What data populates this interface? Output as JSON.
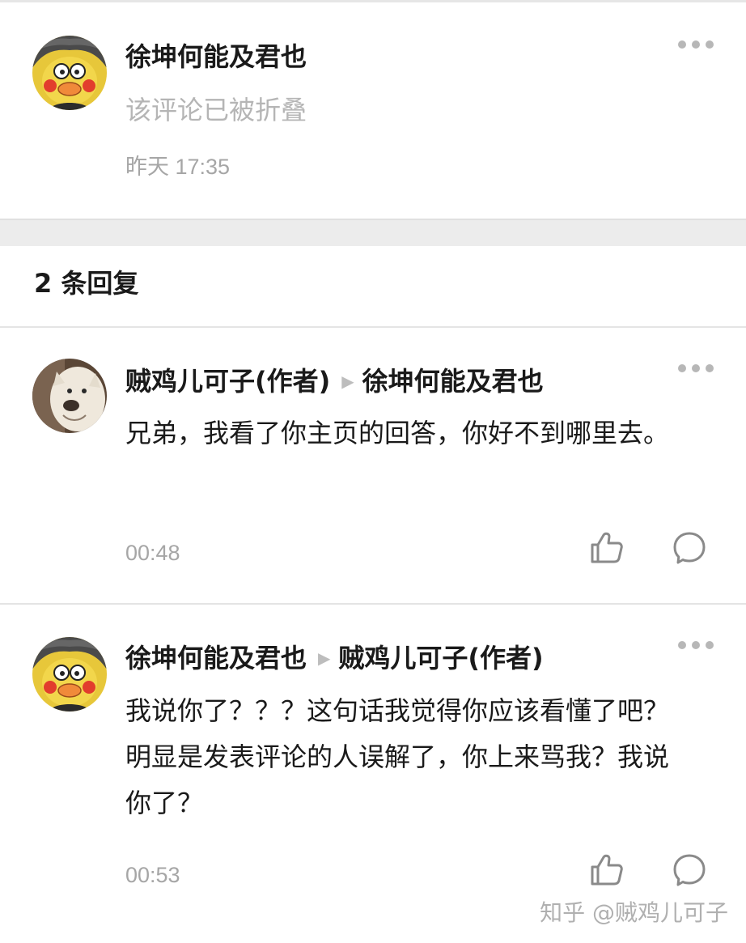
{
  "folded_comment": {
    "author": "徐坤何能及君也",
    "text": "该评论已被折叠",
    "time": "昨天 17:35"
  },
  "replies_header": "2 条回复",
  "replies": [
    {
      "author": "贼鸡儿可子(作者)",
      "reply_to": "徐坤何能及君也",
      "text": "兄弟，我看了你主页的回答，你好不到哪里去。",
      "time": "00:48"
    },
    {
      "author": "徐坤何能及君也",
      "reply_to": "贼鸡儿可子(作者)",
      "text": "我说你了？？？这句话我觉得你应该看懂了吧？明显是发表评论的人误解了，你上来骂我？我说你了？",
      "time": "00:53"
    }
  ],
  "watermark": "知乎 @贼鸡儿可子",
  "icons": {
    "more": "more-dots-icon",
    "like": "thumbs-up-icon",
    "reply": "comment-bubble-icon",
    "reply_arrow": "triangle-right-icon"
  },
  "colors": {
    "text": "#1a1a1a",
    "muted": "#a6a6a6",
    "folded": "#b5b5b5",
    "separator_band": "#ececec"
  }
}
